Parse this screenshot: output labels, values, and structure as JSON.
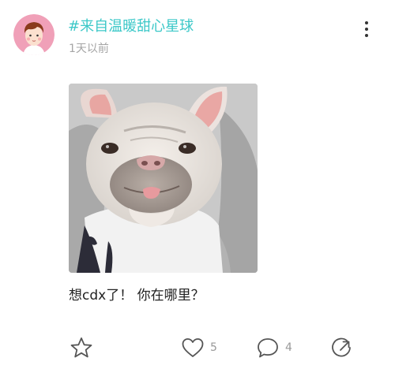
{
  "post": {
    "topic": "#来自温暖甜心星球",
    "time_ago": "1天以前",
    "caption": "想cdx了！ 你在哪里？"
  },
  "actions": {
    "favorite_icon": "star-outline",
    "like_icon": "heart-outline",
    "like_count": "5",
    "comment_icon": "speech-bubble-outline",
    "comment_count": "4",
    "share_icon": "share-circle-arrow"
  },
  "colors": {
    "topic": "#3cc8c8",
    "avatar_bg": "#f0a0b8",
    "muted_text": "#a5a5a5",
    "icon": "#555555"
  }
}
